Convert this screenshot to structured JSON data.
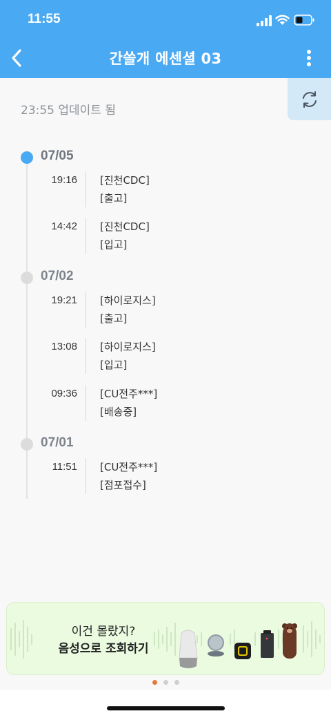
{
  "status_bar": {
    "time": "11:55"
  },
  "nav": {
    "title": "간쓸개 에센셜 03"
  },
  "updated_text": "23:55 업데이트 됨",
  "timeline": [
    {
      "date": "07/05",
      "active": true,
      "events": [
        {
          "time": "19:16",
          "location": "[진천CDC]",
          "status": "[출고]"
        },
        {
          "time": "14:42",
          "location": "[진천CDC]",
          "status": "[입고]"
        }
      ]
    },
    {
      "date": "07/02",
      "active": false,
      "events": [
        {
          "time": "19:21",
          "location": "[하이로지스]",
          "status": "[출고]"
        },
        {
          "time": "13:08",
          "location": "[하이로지스]",
          "status": "[입고]"
        },
        {
          "time": "09:36",
          "location": "[CU전주***]",
          "status": "[배송중]"
        }
      ]
    },
    {
      "date": "07/01",
      "active": false,
      "events": [
        {
          "time": "11:51",
          "location": "[CU전주***]",
          "status": "[점포접수]"
        }
      ]
    }
  ],
  "banner": {
    "line1": "이건 몰랐지?",
    "line2": "음성으로 조회하기"
  },
  "pager": {
    "count": 3,
    "active_index": 0
  },
  "colors": {
    "primary": "#4aa9f3",
    "banner_bg": "#eafbe0",
    "pager_active": "#e57a3a"
  },
  "icons": [
    "back-arrow-icon",
    "more-vertical-icon",
    "refresh-icon",
    "signal-icon",
    "wifi-icon",
    "battery-icon"
  ]
}
